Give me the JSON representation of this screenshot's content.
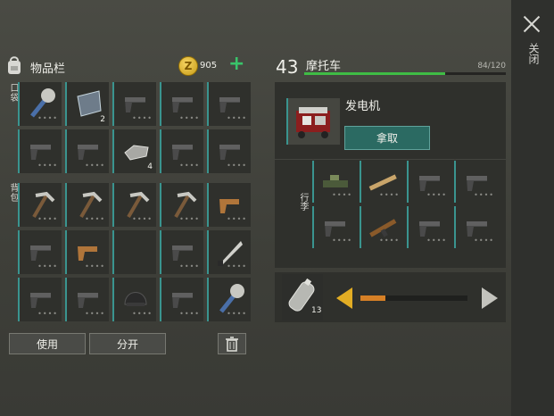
{
  "close_label": "关闭",
  "inventory": {
    "title": "物品栏",
    "coin_count": "905",
    "pocket_label": "口袋",
    "backpack_label": "背包",
    "pocket_slots": [
      {
        "item": "mace-icon",
        "qty": "",
        "dots": true
      },
      {
        "item": "glass-icon",
        "qty": "2",
        "dots": false
      },
      {
        "item": "pistol-icon",
        "qty": "",
        "dots": true
      },
      {
        "item": "pistol-icon",
        "qty": "",
        "dots": true
      },
      {
        "item": "pistol-icon",
        "qty": "",
        "dots": true
      },
      {
        "item": "pistol-icon",
        "qty": "",
        "dots": true
      },
      {
        "item": "pistol-icon",
        "qty": "",
        "dots": true
      },
      {
        "item": "ingot-icon",
        "qty": "4",
        "dots": false
      },
      {
        "item": "pistol-icon",
        "qty": "",
        "dots": true
      },
      {
        "item": "pistol-icon",
        "qty": "",
        "dots": true
      }
    ],
    "backpack_slots": [
      {
        "item": "pickaxe-icon",
        "qty": "",
        "dots": true
      },
      {
        "item": "pickaxe-icon",
        "qty": "",
        "dots": true
      },
      {
        "item": "pickaxe-icon",
        "qty": "",
        "dots": true
      },
      {
        "item": "pickaxe-icon",
        "qty": "",
        "dots": true
      },
      {
        "item": "flare-gun-icon",
        "qty": "",
        "dots": true
      },
      {
        "item": "pistol-icon",
        "qty": "",
        "dots": true
      },
      {
        "item": "flare-gun-icon",
        "qty": "",
        "dots": true
      },
      {
        "item": "empty",
        "qty": "",
        "dots": false
      },
      {
        "item": "pistol-icon",
        "qty": "",
        "dots": true
      },
      {
        "item": "machete-icon",
        "qty": "",
        "dots": true
      },
      {
        "item": "pistol-icon",
        "qty": "",
        "dots": true
      },
      {
        "item": "pistol-icon",
        "qty": "",
        "dots": true
      },
      {
        "item": "helmet-icon",
        "qty": "",
        "dots": true
      },
      {
        "item": "pistol-icon",
        "qty": "",
        "dots": true
      },
      {
        "item": "mace-icon",
        "qty": "",
        "dots": true
      }
    ],
    "use_label": "使用",
    "split_label": "分开"
  },
  "vehicle": {
    "level": "43",
    "name": "摩托车",
    "capacity": "84/120",
    "capacity_fraction": 0.7,
    "generator_name": "发电机",
    "take_label": "拿取",
    "luggage_label": "行李",
    "trunk_slots": [
      {
        "item": "minigun-icon",
        "qty": "",
        "dots": true
      },
      {
        "item": "rifle-icon",
        "qty": "",
        "dots": true
      },
      {
        "item": "pistol-icon",
        "qty": "",
        "dots": true
      },
      {
        "item": "pistol-icon",
        "qty": "",
        "dots": true
      },
      {
        "item": "pistol-icon",
        "qty": "",
        "dots": true
      },
      {
        "item": "ak-rifle-icon",
        "qty": "",
        "dots": true
      },
      {
        "item": "pistol-icon",
        "qty": "",
        "dots": true
      },
      {
        "item": "pistol-icon",
        "qty": "",
        "dots": true
      }
    ]
  },
  "fuel": {
    "qty": "13",
    "slider_fraction": 0.23
  }
}
